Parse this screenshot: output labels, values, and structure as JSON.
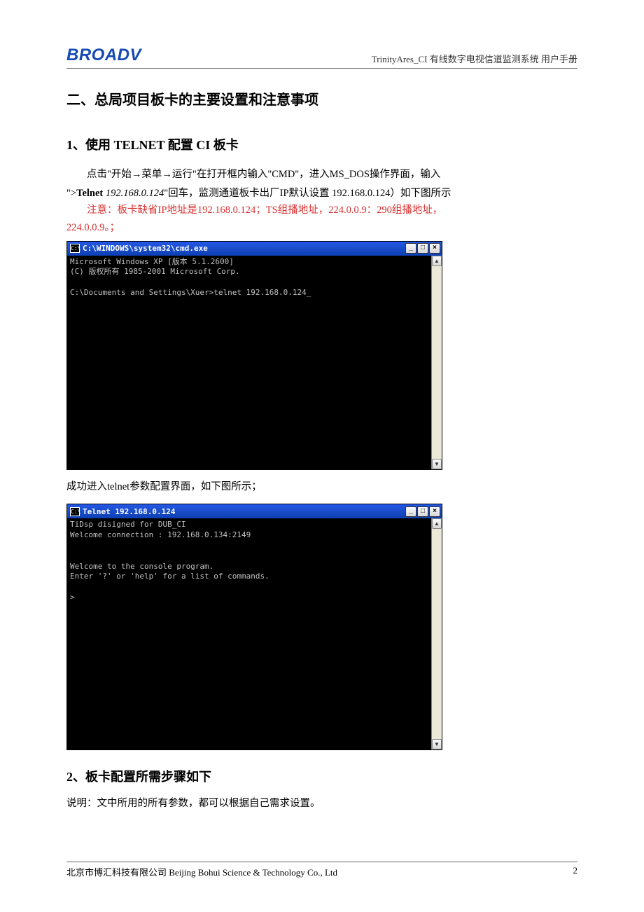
{
  "header": {
    "logo_text": "BROADV",
    "doc_title": "TrinityAres_CI 有线数字电视信道监测系统 用户手册"
  },
  "section": {
    "h1": "二、总局项目板卡的主要设置和注意事项",
    "h2_1": "1、使用 TELNET 配置 CI 板卡",
    "para1_pre": "点击\"开始→菜单→运行\"在打开框内输入\"CMD\"，进入MS_DOS操作界面，输入",
    "para1_quote_open": "\">",
    "para1_bold": "Telnet",
    "para1_italic": " 192.168.0.124",
    "para1_rest": "\"回车，监测通道板卡出厂IP默认设置  192.168.0.124）如下图所示",
    "warn_line1": "注意：板卡缺省IP地址是192.168.0.124；TS组播地址，224.0.0.9：290组播地址，",
    "warn_line2": "224.0.0.9。；",
    "mid_text": "成功进入telnet参数配置界面，如下图所示；",
    "h2_2": "2、板卡配置所需步骤如下",
    "desc": "说明：文中所用的所有参数，都可以根据自己需求设置。"
  },
  "cmd1": {
    "title": "C:\\WINDOWS\\system32\\cmd.exe",
    "icon_label": "C:\\",
    "min_label": "_",
    "max_label": "□",
    "close_label": "×",
    "scroll_up": "▲",
    "scroll_down": "▼",
    "content": "Microsoft Windows XP [版本 5.1.2600]\n(C) 版权所有 1985-2001 Microsoft Corp.\n\nC:\\Documents and Settings\\Xuer>telnet 192.168.0.124_"
  },
  "cmd2": {
    "title": "Telnet 192.168.0.124",
    "icon_label": "C:\\",
    "min_label": "_",
    "max_label": "□",
    "close_label": "×",
    "scroll_up": "▲",
    "scroll_down": "▼",
    "content": "TiDsp disigned for DUB_CI\nWelcome connection : 192.168.0.134:2149\n\n\nWelcome to the console program.\nEnter '?' or 'help' for a list of commands.\n\n>"
  },
  "footer": {
    "company": "北京市博汇科技有限公司 Beijing Bohui Science & Technology Co., Ltd",
    "page_num": "2"
  }
}
